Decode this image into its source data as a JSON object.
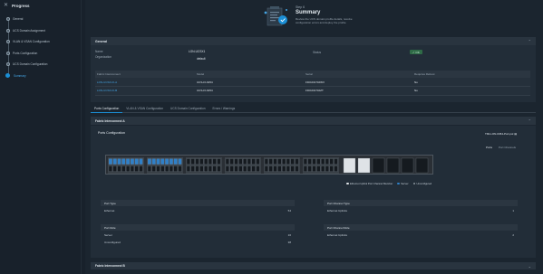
{
  "sidebar": {
    "close_icon": "close-icon",
    "title": "Progress",
    "steps": [
      {
        "label": "General",
        "state": "done"
      },
      {
        "label": "UCS Domain Assignment",
        "state": "done"
      },
      {
        "label": "VLAN & VSAN Configuration",
        "state": "done"
      },
      {
        "label": "Ports Configuration",
        "state": "done"
      },
      {
        "label": "UCS Domain Configuration",
        "state": "done"
      },
      {
        "label": "Summary",
        "state": "active"
      }
    ]
  },
  "hero": {
    "step": "Step 6",
    "title": "Summary",
    "description": "Review the UCS domain profile details, resolve configuration errors and deploy the profile."
  },
  "general": {
    "header": "General",
    "name_label": "Name",
    "name_value": "LON-UCSX1",
    "org_label": "Organization",
    "org_value": "default",
    "status_label": "Status",
    "status_value": "OK",
    "table": {
      "headers": [
        "Fabric Interconnect",
        "Model",
        "Serial",
        "Requires Reboot"
      ],
      "rows": [
        [
          "LON-UCSX-FI-A",
          "UCS-FI-6454",
          "FDO23170JWV",
          "No"
        ],
        [
          "LON-UCSX-FI-B",
          "UCS-FI-6454",
          "FDO23170JZT",
          "No"
        ]
      ]
    }
  },
  "tabs": [
    "Ports Configuration",
    "VLAN & VSAN Configuration",
    "UCS Domain Configuration",
    "Errors / Warnings"
  ],
  "fi_a": {
    "header": "Fabric Interconnect A",
    "port_config_title": "Ports Configuration",
    "port_policy": "TMI-LON-6454-Port.pol",
    "view_tabs": [
      "Ports",
      "Port Channels"
    ],
    "legend": [
      {
        "label": "Ethernet Uplink Port Channel Member",
        "color": "#e0e4e8"
      },
      {
        "label": "Server",
        "color": "#2f80c8"
      },
      {
        "label": "Unconfigured",
        "color": "#8a949e"
      }
    ],
    "port_type": {
      "header": "Port Type",
      "rows": [
        {
          "label": "Ethernet",
          "value": "54"
        }
      ]
    },
    "port_role": {
      "header": "Port Role",
      "rows": [
        {
          "label": "Server",
          "value": "16"
        },
        {
          "label": "Unconfigured",
          "value": "38"
        }
      ]
    },
    "pc_type": {
      "header": "Port Channel Type",
      "rows": [
        {
          "label": "Ethernet Uplinks",
          "value": "1"
        }
      ]
    },
    "pc_role": {
      "header": "Port Channel Role",
      "rows": [
        {
          "label": "Ethernet Uplinks",
          "value": "2"
        }
      ]
    }
  },
  "fi_b": {
    "header": "Fabric Interconnect B"
  },
  "colors": {
    "accent": "#1b8fd6",
    "ok": "#2f6b47",
    "link": "#44a5e4"
  }
}
